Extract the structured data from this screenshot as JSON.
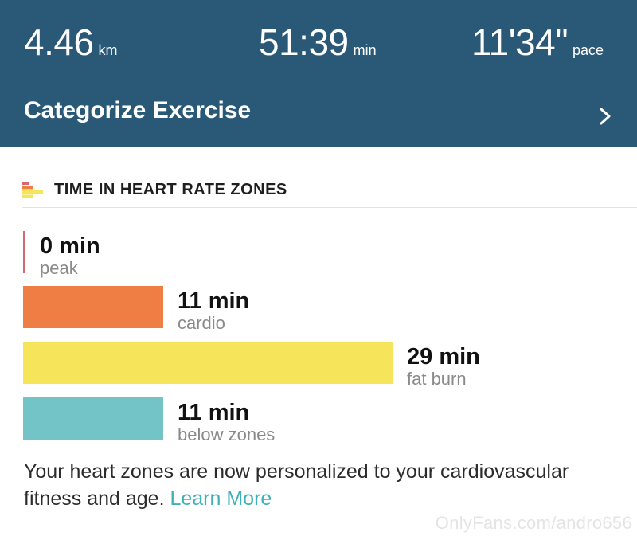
{
  "stats": {
    "distance": {
      "value": "4.46",
      "unit": "km"
    },
    "duration": {
      "value": "51:39",
      "unit": "min"
    },
    "pace": {
      "value": "11'34\"",
      "unit": "pace"
    }
  },
  "categorize_label": "Categorize Exercise",
  "section_title": "TIME IN HEART RATE ZONES",
  "zones": [
    {
      "minutes": "0 min",
      "name": "peak",
      "value": 0,
      "color": "#d9676f"
    },
    {
      "minutes": "11 min",
      "name": "cardio",
      "value": 11,
      "color": "#ef7e45"
    },
    {
      "minutes": "29 min",
      "name": "fat burn",
      "value": 29,
      "color": "#f6e55a"
    },
    {
      "minutes": "11 min",
      "name": "below zones",
      "value": 11,
      "color": "#72c4c6"
    }
  ],
  "note": {
    "text": "Your heart zones are now personalized to your cardiovascular fitness and age.",
    "link": "Learn More"
  },
  "watermark": "OnlyFans.com/andro656",
  "colors": {
    "header_bg": "#2a5977",
    "link": "#3fb0b8"
  }
}
